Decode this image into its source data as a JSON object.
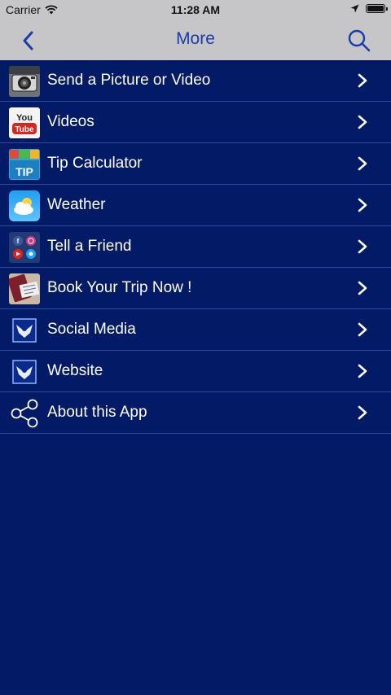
{
  "status_bar": {
    "carrier": "Carrier",
    "time": "11:28 AM",
    "battery_level": 1.0
  },
  "nav": {
    "title": "More",
    "back_icon": "chevron-left-icon",
    "search_icon": "search-icon",
    "accent_color": "#1a3ca8"
  },
  "list": {
    "items": [
      {
        "label": "Send a Picture or Video",
        "icon": "camera-icon"
      },
      {
        "label": "Videos",
        "icon": "youtube-icon"
      },
      {
        "label": "Tip Calculator",
        "icon": "tip-calculator-icon"
      },
      {
        "label": "Weather",
        "icon": "weather-icon"
      },
      {
        "label": "Tell a Friend",
        "icon": "social-apps-icon"
      },
      {
        "label": "Book Your Trip Now !",
        "icon": "travel-booking-icon"
      },
      {
        "label": "Social Media",
        "icon": "eagle-logo-icon"
      },
      {
        "label": "Website",
        "icon": "eagle-logo-icon"
      },
      {
        "label": "About this App",
        "icon": "share-icon"
      }
    ]
  },
  "colors": {
    "background": "#031a66",
    "bar_background": "#c6c6c8",
    "row_text": "#ffffff"
  }
}
